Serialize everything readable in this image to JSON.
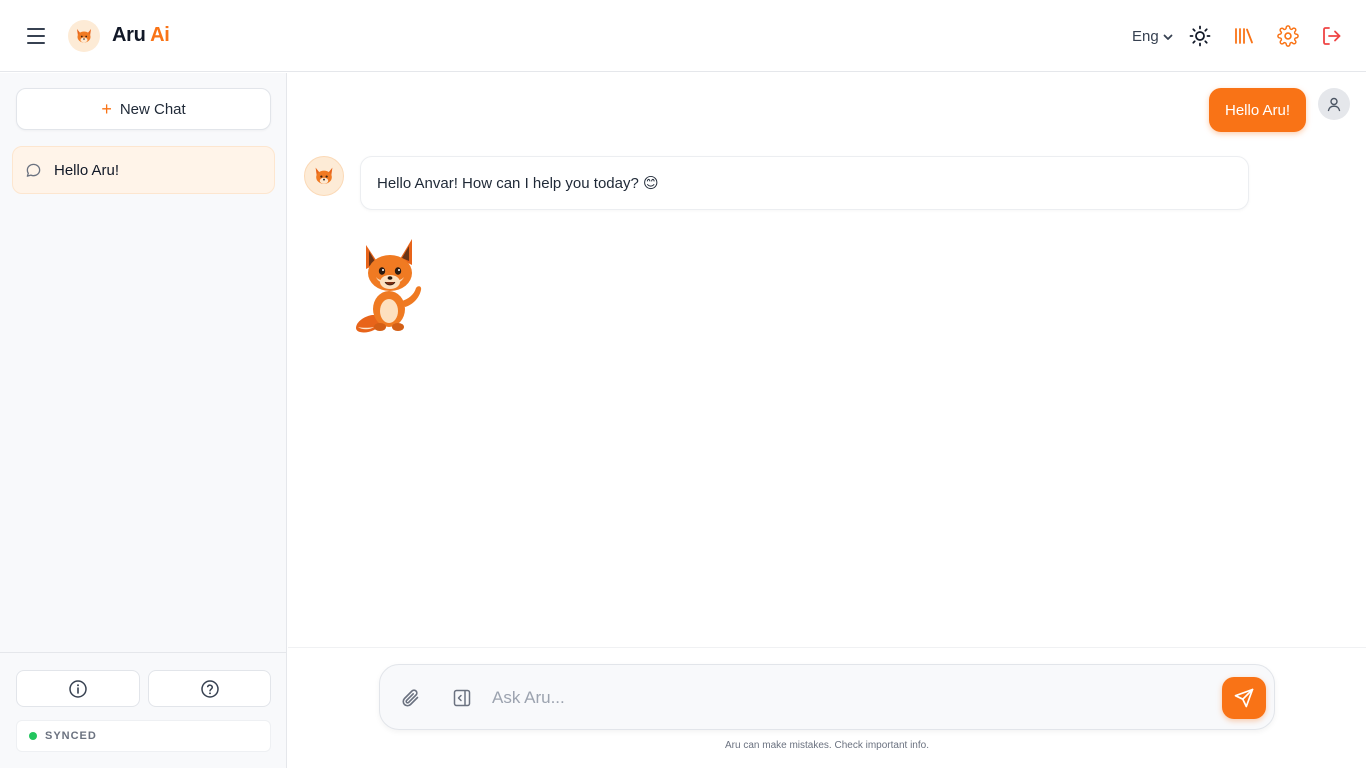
{
  "app": {
    "name_main": "Aru",
    "name_accent": "Ai"
  },
  "header": {
    "language": "Eng",
    "icons": [
      "menu-icon",
      "fox-logo-icon",
      "chevron-down-icon",
      "sun-icon",
      "library-icon",
      "gear-icon",
      "logout-icon"
    ]
  },
  "sidebar": {
    "new_chat_label": "New Chat",
    "chats": [
      {
        "title": "Hello Aru!"
      }
    ],
    "status": "SYNCED"
  },
  "conversation": {
    "messages": [
      {
        "role": "user",
        "text": "Hello Aru!"
      },
      {
        "role": "assistant",
        "text": "Hello Anvar! How can I help you today? 😊"
      }
    ]
  },
  "composer": {
    "placeholder": "Ask Aru...",
    "value": "",
    "disclaimer": "Aru can make mistakes. Check important info."
  },
  "colors": {
    "accent": "#f97316",
    "status_ok": "#22c55e"
  }
}
